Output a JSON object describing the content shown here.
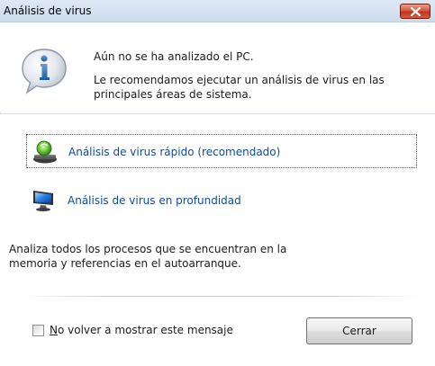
{
  "window": {
    "title": "Análisis de virus"
  },
  "header": {
    "line1": "Aún no se ha analizado el PC.",
    "line2": "Le recomendamos ejecutar un análisis de virus en las principales áreas de sistema.",
    "icon": "info-icon"
  },
  "options": [
    {
      "label": "Análisis de virus rápido (recomendado)",
      "icon": "quick-scan-icon",
      "focused": true
    },
    {
      "label": "Análisis de virus en profundidad",
      "icon": "deep-scan-icon",
      "focused": false
    }
  ],
  "description": "Analiza todos los procesos que se encuentran en la memoria y referencias en el autoarranque.",
  "footer": {
    "checkbox_underline": "N",
    "checkbox_rest": "o volver a mostrar este mensaje",
    "checkbox_checked": false,
    "close_label": "Cerrar"
  },
  "colors": {
    "link": "#0e4a9c",
    "titlebar": "#cddbec",
    "close_red": "#c2341a"
  }
}
